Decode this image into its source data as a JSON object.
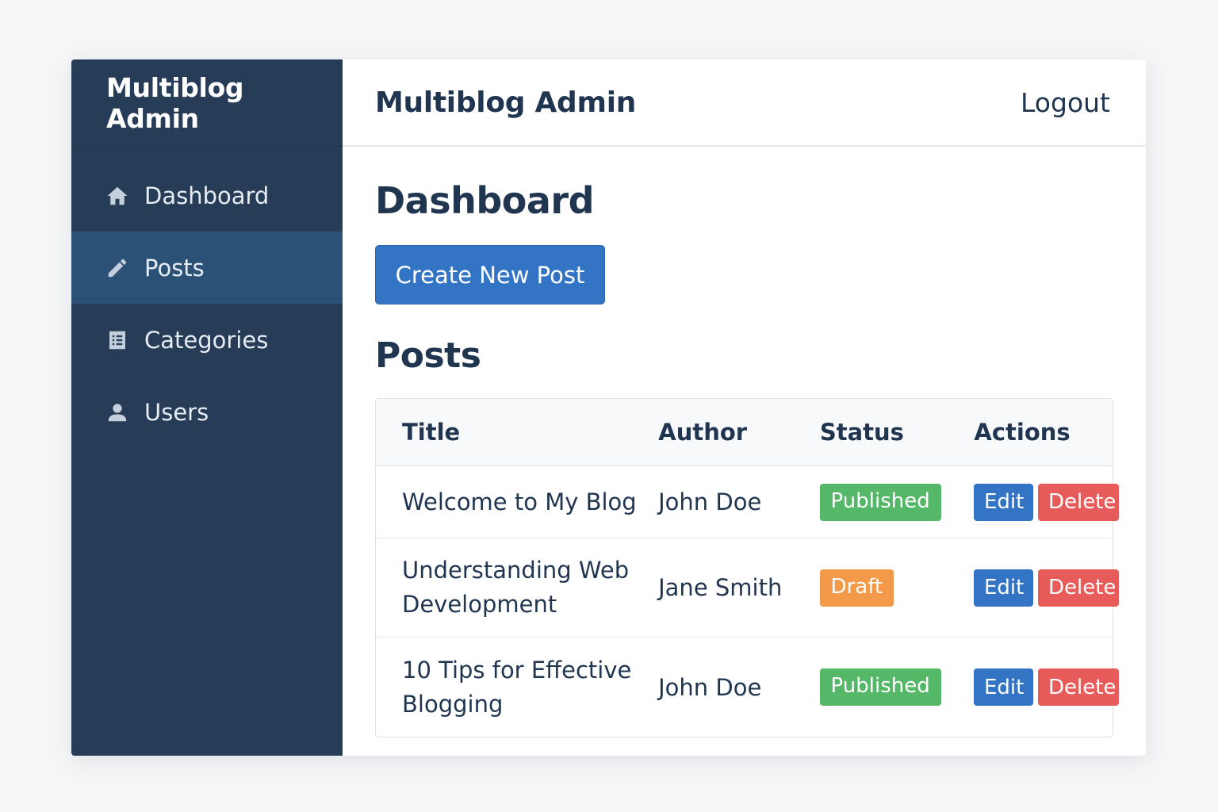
{
  "sidebar": {
    "brand": "Multiblog Admin",
    "items": [
      {
        "label": "Dashboard",
        "icon": "home-icon",
        "active": false
      },
      {
        "label": "Posts",
        "icon": "pencil-icon",
        "active": true
      },
      {
        "label": "Categories",
        "icon": "list-icon",
        "active": false
      },
      {
        "label": "Users",
        "icon": "user-icon",
        "active": false
      }
    ]
  },
  "header": {
    "title": "Multiblog Admin",
    "logout_label": "Logout"
  },
  "main": {
    "page_title": "Dashboard",
    "create_button_label": "Create New Post",
    "section_title": "Posts",
    "table": {
      "columns": [
        "Title",
        "Author",
        "Status",
        "Actions"
      ],
      "rows": [
        {
          "title": "Welcome to My Blog",
          "author": "John Doe",
          "status": "Published",
          "edit": "Edit",
          "delete": "Delete"
        },
        {
          "title": "Understanding Web Development",
          "author": "Jane Smith",
          "status": "Draft",
          "edit": "Edit",
          "delete": "Delete"
        },
        {
          "title": "10 Tips for Effective Blogging",
          "author": "John Doe",
          "status": "Published",
          "edit": "Edit",
          "delete": "Delete"
        }
      ]
    }
  },
  "colors": {
    "sidebar_bg": "#273c56",
    "sidebar_active": "#2c5177",
    "primary": "#3374c4",
    "published": "#55b868",
    "draft": "#f39a4a",
    "danger": "#e85b5b"
  }
}
